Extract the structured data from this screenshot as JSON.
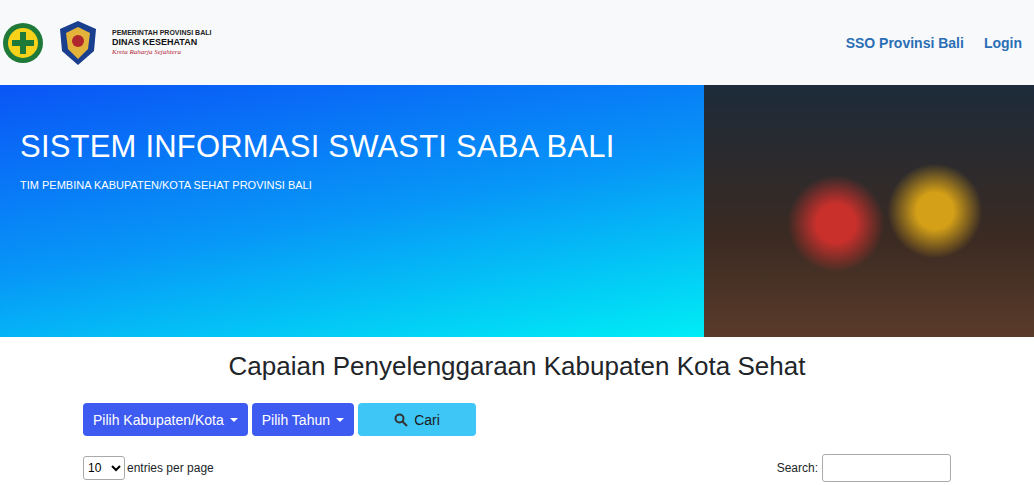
{
  "header": {
    "brand": {
      "agency_line": "PEMERINTAH PROVINSI BALI",
      "department": "DINAS KESEHATAN",
      "tagline": "Kreta Raharja Sejahtera"
    },
    "nav": [
      {
        "label": "SSO Provinsi Bali"
      },
      {
        "label": "Login"
      }
    ]
  },
  "hero": {
    "title": "SISTEM INFORMASI SWASTI SABA BALI",
    "subtitle": "TIM PEMBINA KABUPATEN/KOTA SEHAT PROVINSI BALI"
  },
  "page": {
    "heading": "Capaian Penyelenggaraan Kabupaten Kota Sehat"
  },
  "filters": [
    {
      "label": "Pilih Kabupaten/Kota",
      "kind": "dropdown"
    },
    {
      "label": "Pilih Tahun",
      "kind": "dropdown"
    },
    {
      "label": "Cari",
      "kind": "search"
    }
  ],
  "table_controls": {
    "page_size": "10",
    "page_size_suffix": "entries per page",
    "search_label": "Search:",
    "search_value": ""
  }
}
